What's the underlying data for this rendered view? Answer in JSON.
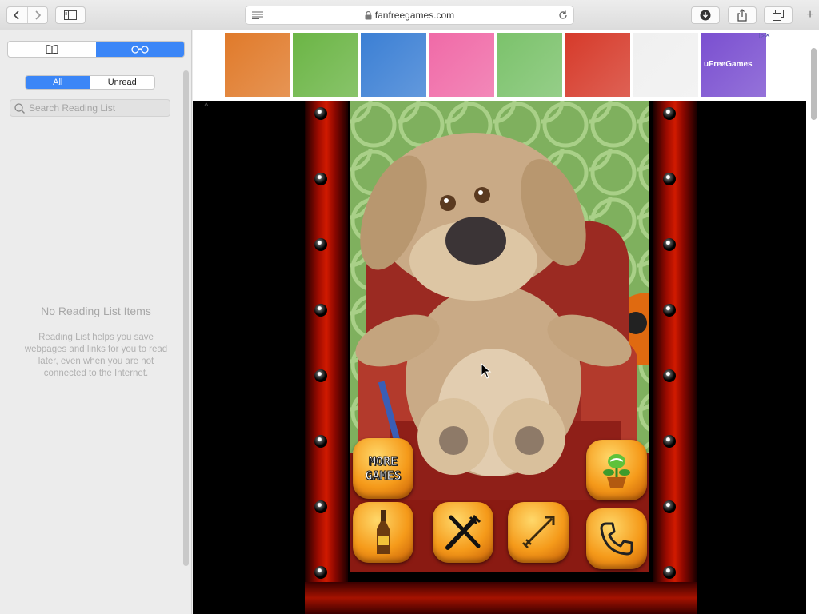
{
  "toolbar": {
    "url": "fanfreegames.com",
    "add_tab": "+"
  },
  "sidebar": {
    "filter": {
      "all": "All",
      "unread": "Unread"
    },
    "search": {
      "placeholder": "Search Reading List"
    },
    "empty_title": "No Reading List Items",
    "empty_description": "Reading List helps you save webpages and links for you to read later, even when you are not connected to the Internet."
  },
  "ads": {
    "choice": "▷✕",
    "thumb_colors": [
      "#e07a2a",
      "#6bb545",
      "#3b7fd4",
      "#f06aa7",
      "#7bc26b",
      "#d63a2a",
      "#f0f0f0",
      "#7a4fd0"
    ],
    "thumb_text": [
      "",
      "",
      "",
      "",
      "",
      "",
      "",
      "uFreeGames"
    ]
  },
  "game": {
    "more_games": "MORE GAMES",
    "accent": "#f59a1a"
  }
}
